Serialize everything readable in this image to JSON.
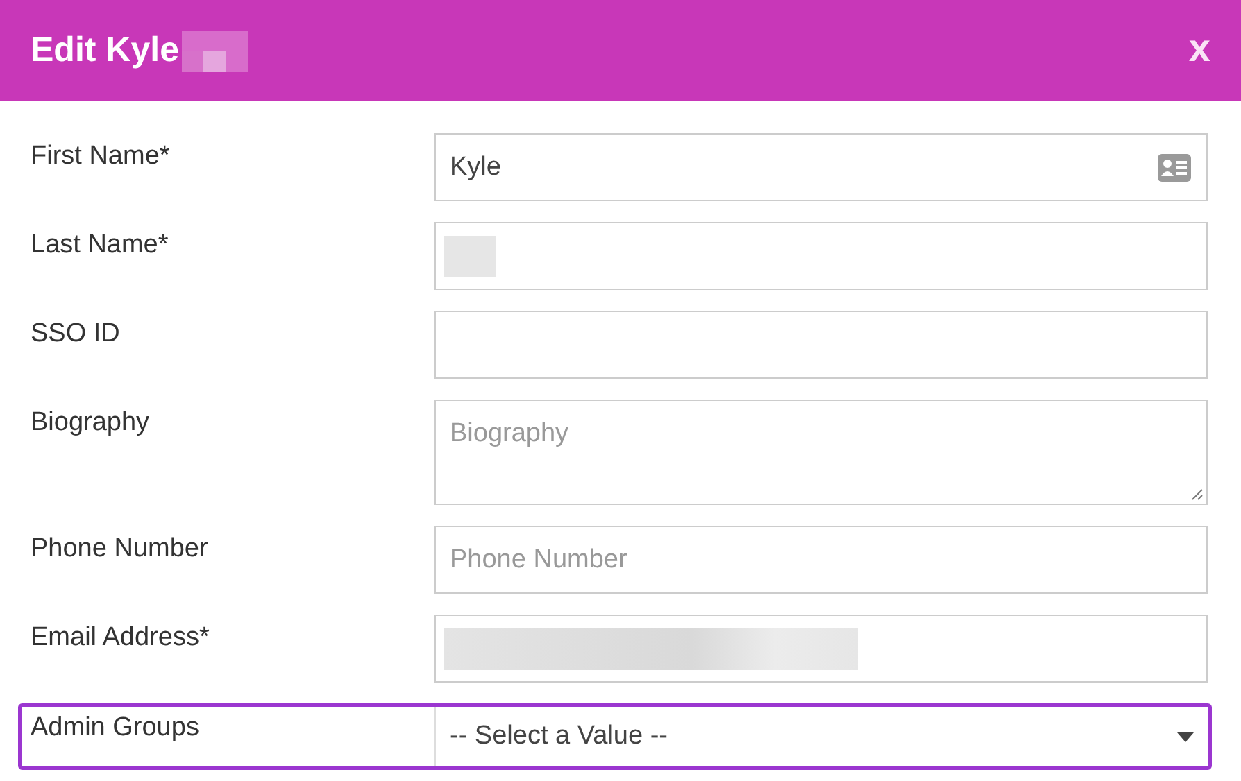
{
  "dialog": {
    "title": "Edit Kyle",
    "title_redacted": true,
    "close": "x"
  },
  "fields": [
    {
      "label": "First Name*",
      "kind": "text",
      "value": "Kyle",
      "card_icon": true
    },
    {
      "label": "Last Name*",
      "kind": "text",
      "redacted": true
    },
    {
      "label": "SSO ID",
      "kind": "text"
    },
    {
      "label": "Biography",
      "kind": "textarea",
      "placeholder": "Biography"
    },
    {
      "label": "Phone Number",
      "kind": "text",
      "placeholder": "Phone Number"
    },
    {
      "label": "Email Address*",
      "kind": "text",
      "redacted": true,
      "wide_redaction": true
    },
    {
      "label": "Admin Groups",
      "kind": "select",
      "value": "-- Select a Value --",
      "highlighted": true
    }
  ]
}
